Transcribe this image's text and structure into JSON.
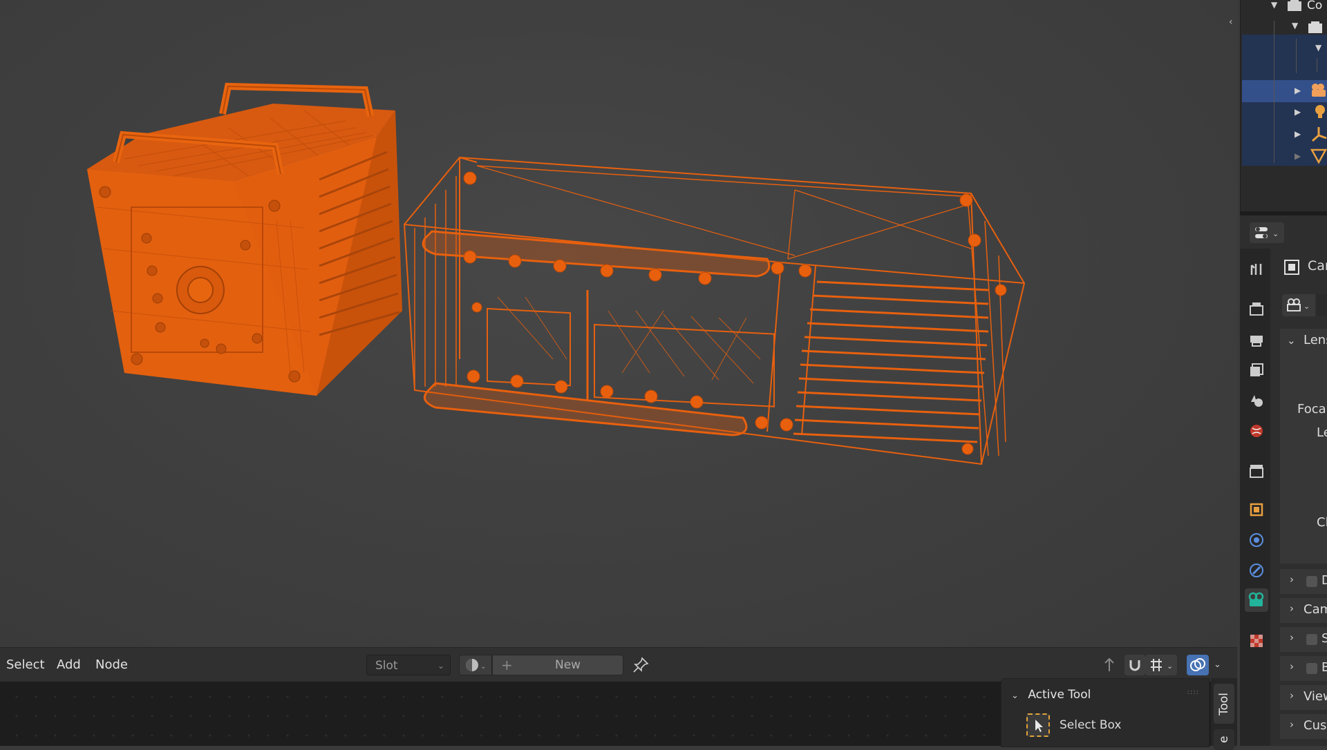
{
  "app": "Blender",
  "viewport": {
    "description_objects": [
      "camera-body-wireframe",
      "camera-cage-wireframe"
    ],
    "wire_color": "#e8600e"
  },
  "node_editor": {
    "menu": {
      "select": "Select",
      "add": "Add",
      "node": "Node"
    },
    "slot": "Slot",
    "new_label": "New"
  },
  "tool_panel": {
    "header": "Active Tool",
    "tool_name": "Select Box",
    "tab_tool": "Tool",
    "tab_view": "e"
  },
  "properties": {
    "object_name": "Car",
    "lens_section": "Lens",
    "focal_label": "Focal",
    "lens_label": "Le",
    "clip_label": "Cl",
    "sections": [
      {
        "label": "D",
        "checkbox": true
      },
      {
        "label": "Cam",
        "checkbox": false
      },
      {
        "label": "S",
        "checkbox": true
      },
      {
        "label": "B",
        "checkbox": true
      },
      {
        "label": "View",
        "checkbox": false
      },
      {
        "label": "Cust",
        "checkbox": false
      }
    ]
  },
  "outliner": {
    "top_label": "Co"
  },
  "colors": {
    "accent": "#e8600e",
    "selection": "#34508a",
    "active_tab": "#22b59b"
  }
}
